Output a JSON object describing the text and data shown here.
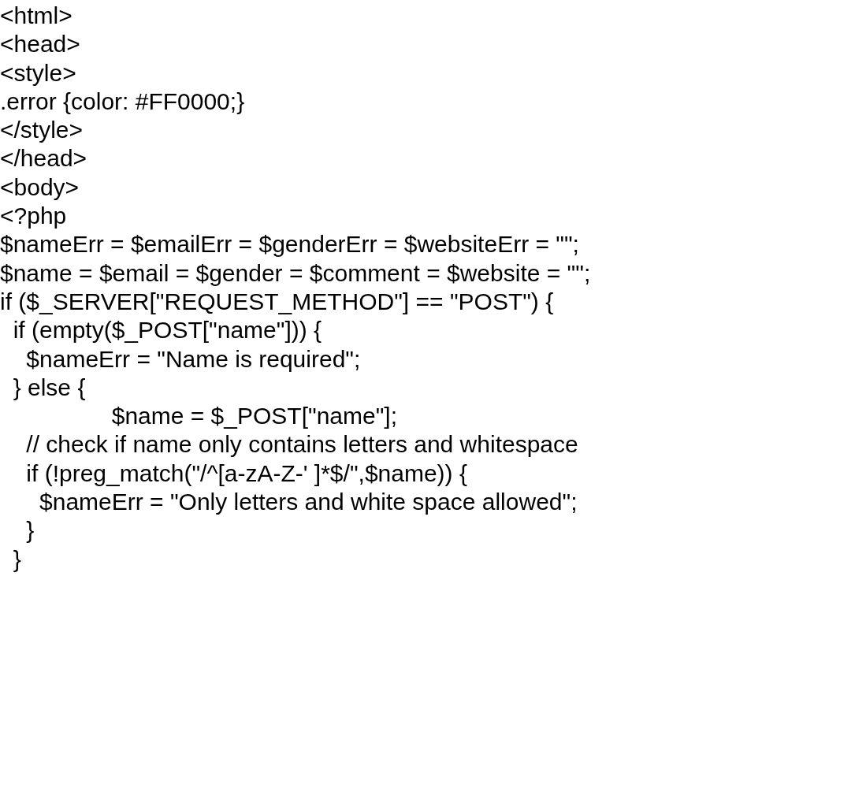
{
  "code_lines": [
    "<html>",
    "<head>",
    "<style>",
    ".error {color: #FF0000;}",
    "</style>",
    "</head>",
    "<body>",
    "<?php",
    "$nameErr = $emailErr = $genderErr = $websiteErr = \"\";",
    "$name = $email = $gender = $comment = $website = \"\";",
    "if ($_SERVER[\"REQUEST_METHOD\"] == \"POST\") {",
    "  if (empty($_POST[\"name\"])) {",
    "    $nameErr = \"Name is required\";",
    "  } else {",
    "                 $name = $_POST[\"name\"];",
    "    // check if name only contains letters and whitespace",
    "    if (!preg_match(\"/^[a-zA-Z-' ]*$/\",$name)) {",
    "      $nameErr = \"Only letters and white space allowed\";",
    "    }",
    "  }"
  ]
}
